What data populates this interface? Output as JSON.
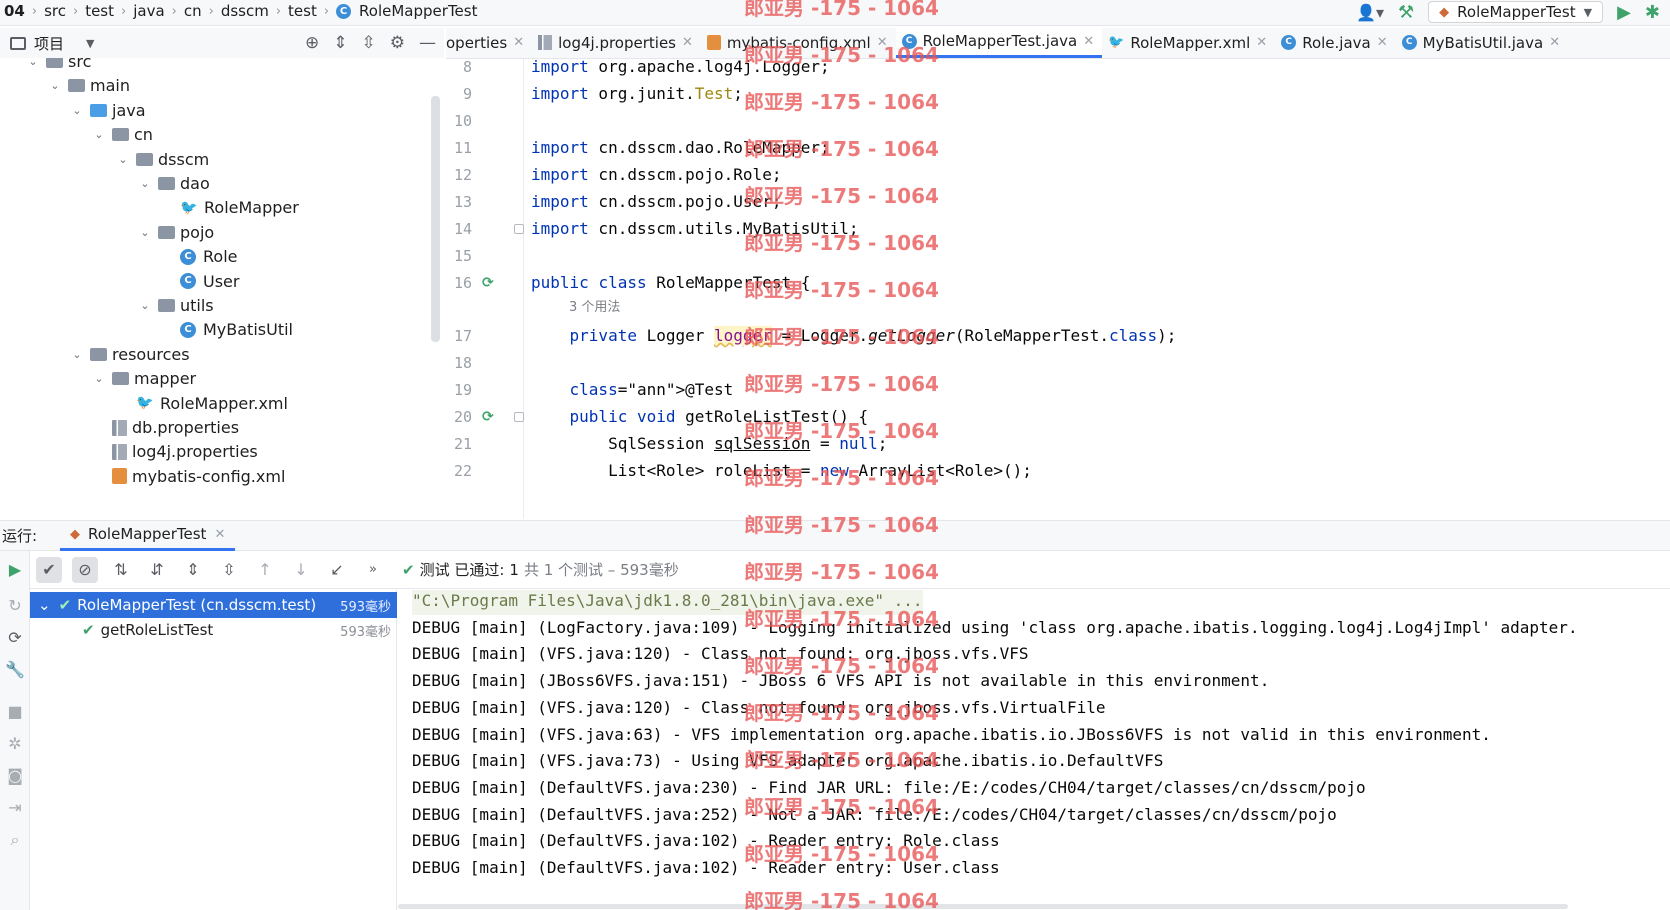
{
  "breadcrumbs": [
    "04",
    "src",
    "test",
    "java",
    "cn",
    "dsscm",
    "test"
  ],
  "breadcrumb_file": "RoleMapperTest",
  "run_config": {
    "label": "RoleMapperTest"
  },
  "project_panel": {
    "title": "项目"
  },
  "tree": [
    {
      "label": "src",
      "kind": "folder",
      "depth": 0,
      "expanded": true
    },
    {
      "label": "main",
      "kind": "folder",
      "depth": 1,
      "expanded": true
    },
    {
      "label": "java",
      "kind": "folder-blue",
      "depth": 2,
      "expanded": true
    },
    {
      "label": "cn",
      "kind": "folder",
      "depth": 3,
      "expanded": true
    },
    {
      "label": "dsscm",
      "kind": "folder",
      "depth": 4,
      "expanded": true
    },
    {
      "label": "dao",
      "kind": "folder",
      "depth": 5,
      "expanded": true
    },
    {
      "label": "RoleMapper",
      "kind": "mybatis",
      "depth": 6
    },
    {
      "label": "pojo",
      "kind": "folder",
      "depth": 5,
      "expanded": true
    },
    {
      "label": "Role",
      "kind": "class",
      "depth": 6
    },
    {
      "label": "User",
      "kind": "class",
      "depth": 6
    },
    {
      "label": "utils",
      "kind": "folder",
      "depth": 5,
      "expanded": true
    },
    {
      "label": "MyBatisUtil",
      "kind": "class",
      "depth": 6
    },
    {
      "label": "resources",
      "kind": "folder",
      "depth": 2,
      "expanded": true
    },
    {
      "label": "mapper",
      "kind": "folder",
      "depth": 3,
      "expanded": true
    },
    {
      "label": "RoleMapper.xml",
      "kind": "mybatis",
      "depth": 4
    },
    {
      "label": "db.properties",
      "kind": "properties",
      "depth": 3
    },
    {
      "label": "log4j.properties",
      "kind": "properties",
      "depth": 3
    },
    {
      "label": "mybatis-config.xml",
      "kind": "xml",
      "depth": 3
    }
  ],
  "editor_tabs": [
    {
      "label": "operties",
      "icon": "none"
    },
    {
      "label": "log4j.properties",
      "icon": "properties"
    },
    {
      "label": "mybatis-config.xml",
      "icon": "xml"
    },
    {
      "label": "RoleMapperTest.java",
      "icon": "class",
      "active": true
    },
    {
      "label": "RoleMapper.xml",
      "icon": "mybatis"
    },
    {
      "label": "Role.java",
      "icon": "class"
    },
    {
      "label": "MyBatisUtil.java",
      "icon": "class"
    }
  ],
  "code_lines": [
    {
      "n": "8",
      "text": "import org.apache.log4j.Logger;"
    },
    {
      "n": "9",
      "text": "import org.junit.Test;"
    },
    {
      "n": "10",
      "text": ""
    },
    {
      "n": "11",
      "text": "import cn.dsscm.dao.RoleMapper;"
    },
    {
      "n": "12",
      "text": "import cn.dsscm.pojo.Role;"
    },
    {
      "n": "13",
      "text": "import cn.dsscm.pojo.User;"
    },
    {
      "n": "14",
      "text": "import cn.dsscm.utils.MyBatisUtil;"
    },
    {
      "n": "15",
      "text": ""
    },
    {
      "n": "16",
      "text": "public class RoleMapperTest {"
    },
    {
      "n": "17",
      "text": "    private Logger logger = Logger.getLogger(RoleMapperTest.class);"
    },
    {
      "n": "18",
      "text": ""
    },
    {
      "n": "19",
      "text": "    @Test"
    },
    {
      "n": "20",
      "text": "    public void getRoleListTest() {"
    },
    {
      "n": "21",
      "text": "        SqlSession sqlSession = null;"
    },
    {
      "n": "22",
      "text": "        List<Role> roleList = new ArrayList<Role>();"
    }
  ],
  "usages_hint": "3 个用法",
  "run_panel": {
    "label": "运行:",
    "tab": "RoleMapperTest",
    "status_prefix": "测试 已通过:",
    "status_count": "1",
    "status_detail": "共 1 个测试 – 593毫秒"
  },
  "test_tree": [
    {
      "label": "RoleMapperTest (cn.dsscm.test)",
      "time": "593毫秒",
      "selected": true
    },
    {
      "label": "getRoleListTest",
      "time": "593毫秒",
      "selected": false
    }
  ],
  "console_lines": [
    "\"C:\\Program Files\\Java\\jdk1.8.0_281\\bin\\java.exe\" ...",
    "DEBUG [main] (LogFactory.java:109) - Logging initialized using 'class org.apache.ibatis.logging.log4j.Log4jImpl' adapter.",
    "DEBUG [main] (VFS.java:120) - Class not found: org.jboss.vfs.VFS",
    "DEBUG [main] (JBoss6VFS.java:151) - JBoss 6 VFS API is not available in this environment.",
    "DEBUG [main] (VFS.java:120) - Class not found: org.jboss.vfs.VirtualFile",
    "DEBUG [main] (VFS.java:63) - VFS implementation org.apache.ibatis.io.JBoss6VFS is not valid in this environment.",
    "DEBUG [main] (VFS.java:73) - Using VFS adapter org.apache.ibatis.io.DefaultVFS",
    "DEBUG [main] (DefaultVFS.java:230) - Find JAR URL: file:/E:/codes/CH04/target/classes/cn/dsscm/pojo",
    "DEBUG [main] (DefaultVFS.java:252) - Not a JAR: file:/E:/codes/CH04/target/classes/cn/dsscm/pojo",
    "DEBUG [main] (DefaultVFS.java:102) - Reader entry: Role.class",
    "DEBUG [main] (DefaultVFS.java:102) - Reader entry: User.class"
  ],
  "watermark": "郎亚男 -175 - 1064",
  "colors": {
    "accent": "#3574f0",
    "pass_green": "#3ea36a",
    "keyword": "#0033b3",
    "annotation": "#9e880d",
    "field": "#871094",
    "watermark": "#e85454"
  }
}
